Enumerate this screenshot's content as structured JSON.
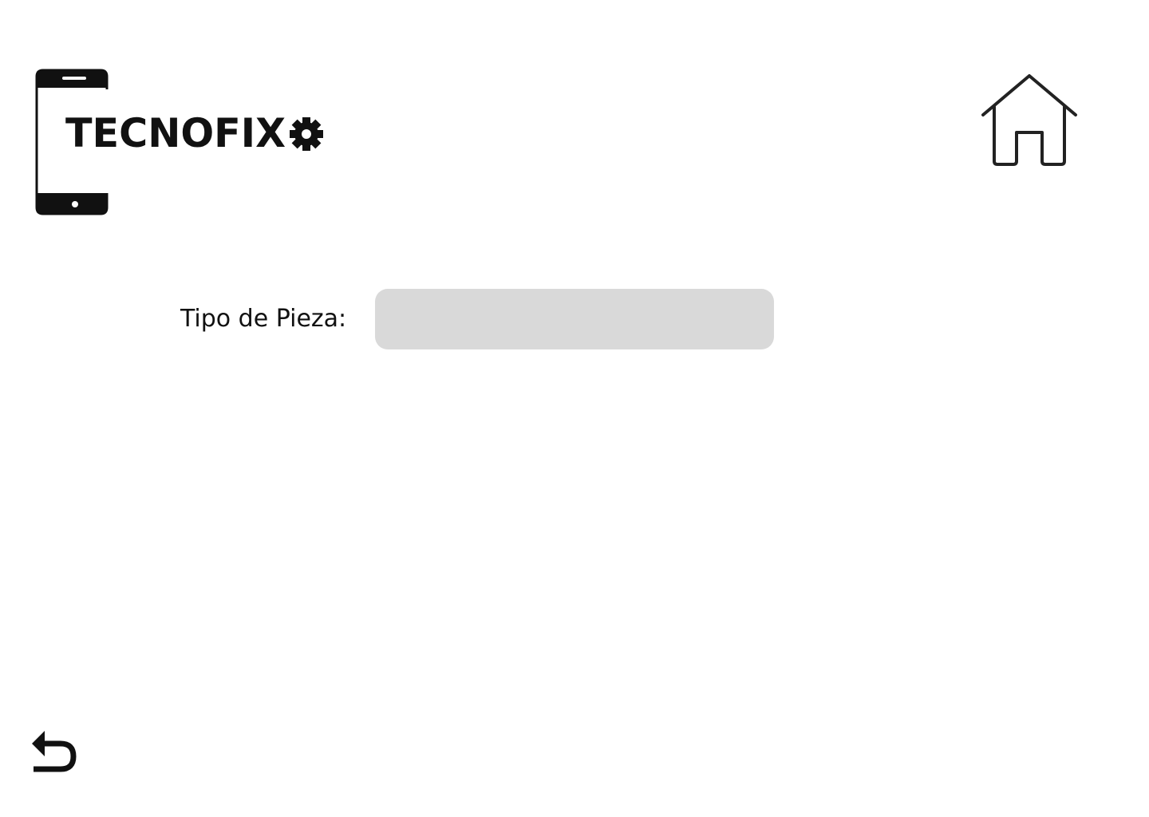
{
  "brand": {
    "name": "TECNOFIX",
    "logo_icon": "smartphone-gear-logo"
  },
  "header": {
    "home_icon": "home-icon"
  },
  "form": {
    "piece_type": {
      "label": "Tipo de Pieza:",
      "value": "",
      "placeholder": ""
    }
  },
  "footer": {
    "back_icon": "undo-arrow-icon"
  },
  "colors": {
    "background": "#ffffff",
    "text": "#111111",
    "input_background": "#d9d9d9",
    "icon": "#111111"
  }
}
